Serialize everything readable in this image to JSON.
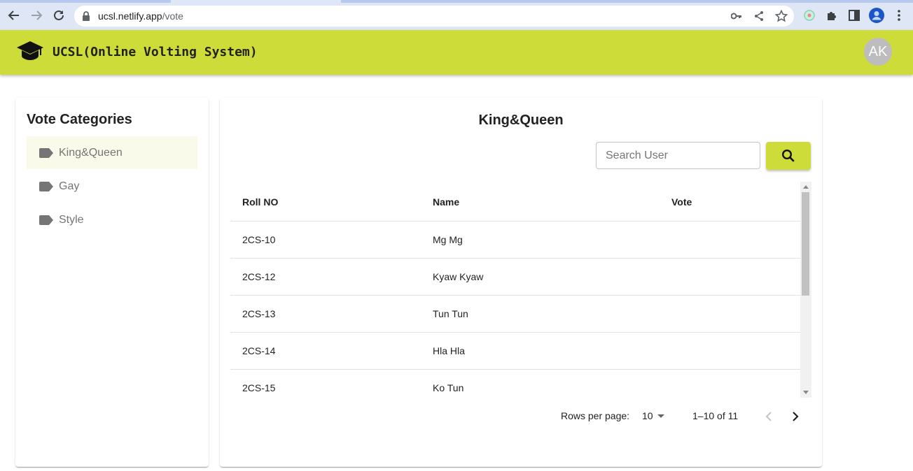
{
  "browser": {
    "url_host": "ucsl.netlify.app",
    "url_path": "/vote"
  },
  "appbar": {
    "title": "UCSL(Online Volting System)",
    "avatar_initials": "AK",
    "color": "#cddc39"
  },
  "categories": {
    "heading": "Vote Categories",
    "items": [
      {
        "label": "King&Queen",
        "selected": true
      },
      {
        "label": "Gay",
        "selected": false
      },
      {
        "label": "Style",
        "selected": false
      }
    ]
  },
  "main": {
    "title": "King&Queen",
    "search": {
      "placeholder": "Search User",
      "button_icon": "search-icon"
    },
    "table": {
      "headers": [
        "Roll NO",
        "Name",
        "Vote"
      ],
      "rows": [
        {
          "roll": "2CS-10",
          "name": "Mg Mg",
          "vote": ""
        },
        {
          "roll": "2CS-12",
          "name": "Kyaw Kyaw",
          "vote": ""
        },
        {
          "roll": "2CS-13",
          "name": "Tun Tun",
          "vote": ""
        },
        {
          "roll": "2CS-14",
          "name": "Hla Hla",
          "vote": ""
        },
        {
          "roll": "2CS-15",
          "name": "Ko Tun",
          "vote": ""
        }
      ]
    },
    "pagination": {
      "rows_per_page_label": "Rows per page:",
      "rows_per_page": "10",
      "range": "1–10 of 11"
    }
  }
}
